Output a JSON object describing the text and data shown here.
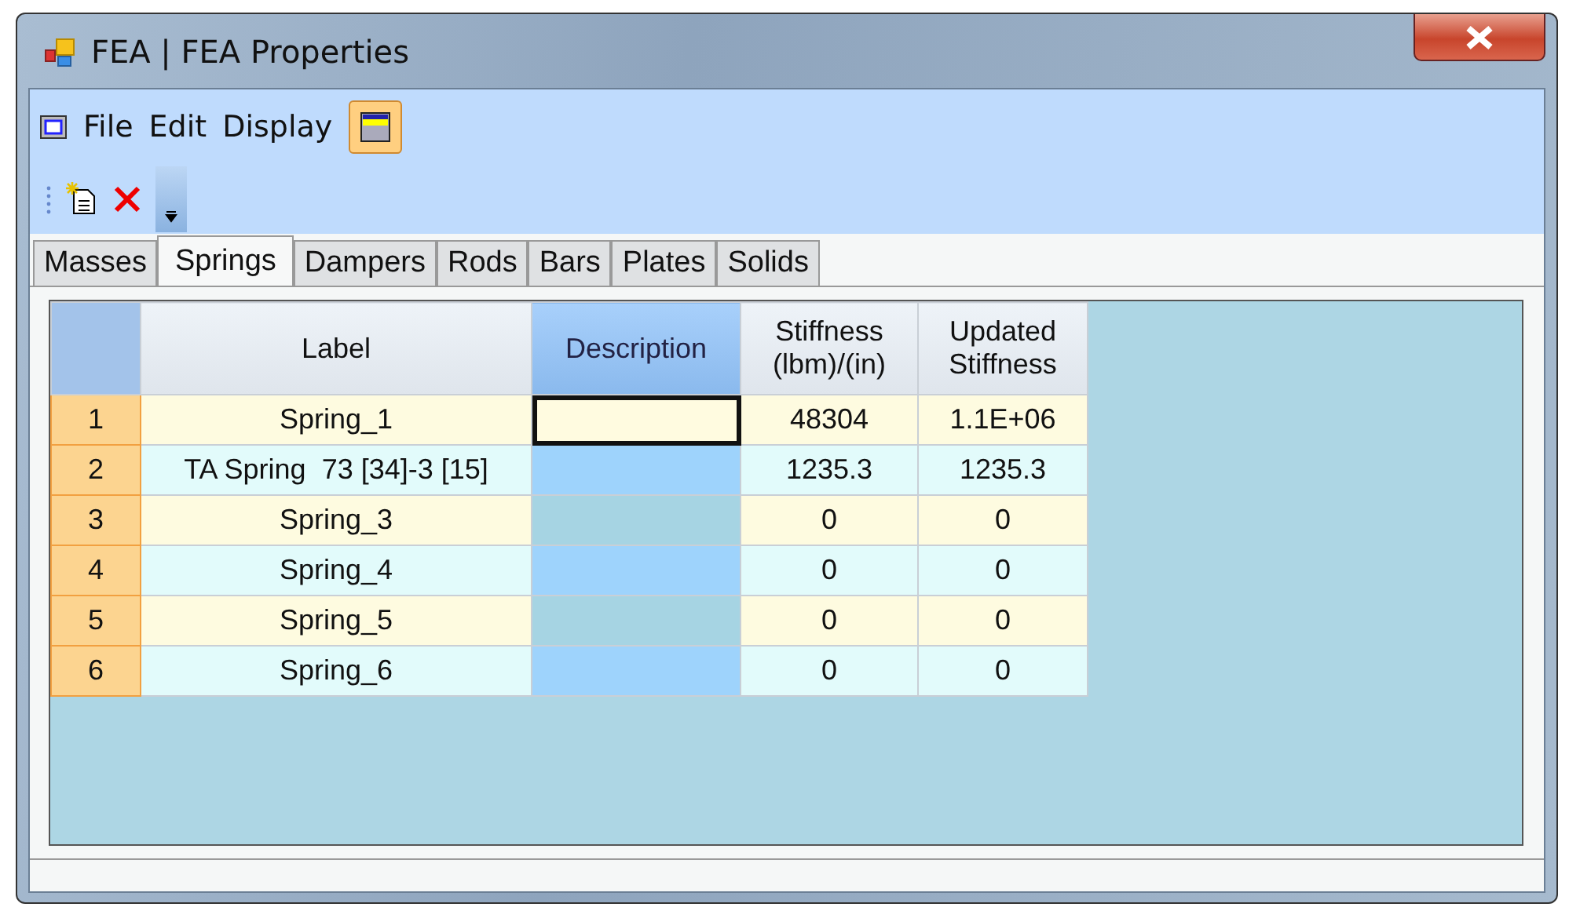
{
  "window": {
    "title": "FEA | FEA Properties"
  },
  "menu": [
    {
      "label": "File"
    },
    {
      "label": "Edit"
    },
    {
      "label": "Display"
    }
  ],
  "tabs": [
    {
      "label": "Masses",
      "selected": false
    },
    {
      "label": "Springs",
      "selected": true
    },
    {
      "label": "Dampers",
      "selected": false
    },
    {
      "label": "Rods",
      "selected": false
    },
    {
      "label": "Bars",
      "selected": false
    },
    {
      "label": "Plates",
      "selected": false
    },
    {
      "label": "Solids",
      "selected": false
    }
  ],
  "table": {
    "columns": [
      {
        "label": "Label",
        "selected": false
      },
      {
        "label": "Description",
        "selected": true
      },
      {
        "label": "Stiffness (lbm)/(in)",
        "selected": false
      },
      {
        "label": "Updated Stiffness",
        "selected": false
      }
    ],
    "rows": [
      {
        "index": "1",
        "label": "Spring_1",
        "stiffness": "48304",
        "updated": "1.1E+06",
        "focused": true
      },
      {
        "index": "2",
        "label": "TA Spring  73 [34]-3 [15]",
        "stiffness": "1235.3",
        "updated": "1235.3",
        "focused": false
      },
      {
        "index": "3",
        "label": "Spring_3",
        "stiffness": "0",
        "updated": "0",
        "focused": false
      },
      {
        "index": "4",
        "label": "Spring_4",
        "stiffness": "0",
        "updated": "0",
        "focused": false
      },
      {
        "index": "5",
        "label": "Spring_5",
        "stiffness": "0",
        "updated": "0",
        "focused": false
      },
      {
        "index": "6",
        "label": "Spring_6",
        "stiffness": "0",
        "updated": "0",
        "focused": false
      }
    ]
  }
}
